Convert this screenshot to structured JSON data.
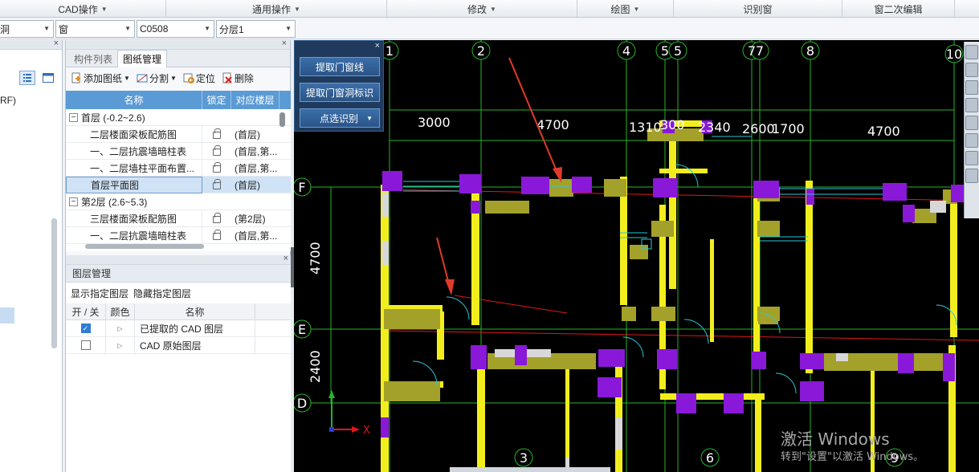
{
  "ribbon": {
    "groups": [
      {
        "label": "CAD操作",
        "has_caret": true
      },
      {
        "label": "通用操作",
        "has_caret": true
      },
      {
        "label": "修改",
        "has_caret": true
      },
      {
        "label": "绘图",
        "has_caret": true
      },
      {
        "label": "识别窗",
        "has_caret": false
      },
      {
        "label": "窗二次编辑",
        "has_caret": false
      }
    ]
  },
  "filters": {
    "combo1": "洞",
    "combo2": "窗",
    "combo3": "C0508",
    "combo4": "分层1"
  },
  "left_stub": {
    "text": "RF)"
  },
  "panel": {
    "tabs": [
      "构件列表",
      "图纸管理"
    ],
    "toolbar": {
      "add": "添加图纸",
      "split": "分割",
      "locate": "定位",
      "delete": "删除"
    },
    "columns": [
      "名称",
      "锁定",
      "对应楼层"
    ],
    "rows": [
      {
        "name": "首层 (-0.2~2.6)",
        "lock": false,
        "floor": "",
        "group": true
      },
      {
        "name": "二层楼面梁板配筋图",
        "lock": true,
        "floor": "(首层)",
        "group": false
      },
      {
        "name": "一、二层抗震墙暗柱表",
        "lock": true,
        "floor": "(首层,第...",
        "group": false
      },
      {
        "name": "一、二层墙柱平面布置...",
        "lock": true,
        "floor": "(首层,第...",
        "group": false
      },
      {
        "name": "首层平面图",
        "lock": true,
        "floor": "(首层)",
        "group": false,
        "selected": true
      },
      {
        "name": "第2层 (2.6~5.3)",
        "lock": false,
        "floor": "",
        "group": true
      },
      {
        "name": "三层楼面梁板配筋图",
        "lock": true,
        "floor": "(第2层)",
        "group": false
      },
      {
        "name": "一、二层抗震墙暗柱表",
        "lock": true,
        "floor": "(首层,第...",
        "group": false
      }
    ]
  },
  "layers": {
    "title": "图层管理",
    "show_link": "显示指定图层",
    "hide_link": "隐藏指定图层",
    "columns": [
      "开 / 关",
      "颜色",
      "名称"
    ],
    "rows": [
      {
        "on": true,
        "name": "已提取的 CAD 图层"
      },
      {
        "on": false,
        "name": "CAD 原始图层"
      }
    ]
  },
  "overlay": {
    "btn1": "提取门窗线",
    "btn2": "提取门窗洞标识",
    "btn3": "点选识别"
  },
  "canvas": {
    "axis_top": [
      "1",
      "2",
      "4",
      "5",
      "5",
      "7",
      "7",
      "8",
      "10"
    ],
    "axis_left": [
      "F",
      "E",
      "D"
    ],
    "axis_bottom": [
      "3",
      "6",
      "9"
    ],
    "dims_top": [
      "3000",
      "4700",
      "1310",
      "300",
      "2340",
      "2600",
      "1700",
      "4700"
    ],
    "dims_left": [
      "4700",
      "2400"
    ],
    "coord_x": "X",
    "colors": {
      "wall_yellow": "#f2ee1e",
      "column_purple": "#8a18d8",
      "olive": "#a3a12a",
      "grid_green": "#27b42a",
      "door_cyan": "#29c7d8",
      "red": "#e01818"
    }
  },
  "watermark": {
    "line1": "激活 Windows",
    "line2": "转到\"设置\"以激活 Windows。"
  }
}
